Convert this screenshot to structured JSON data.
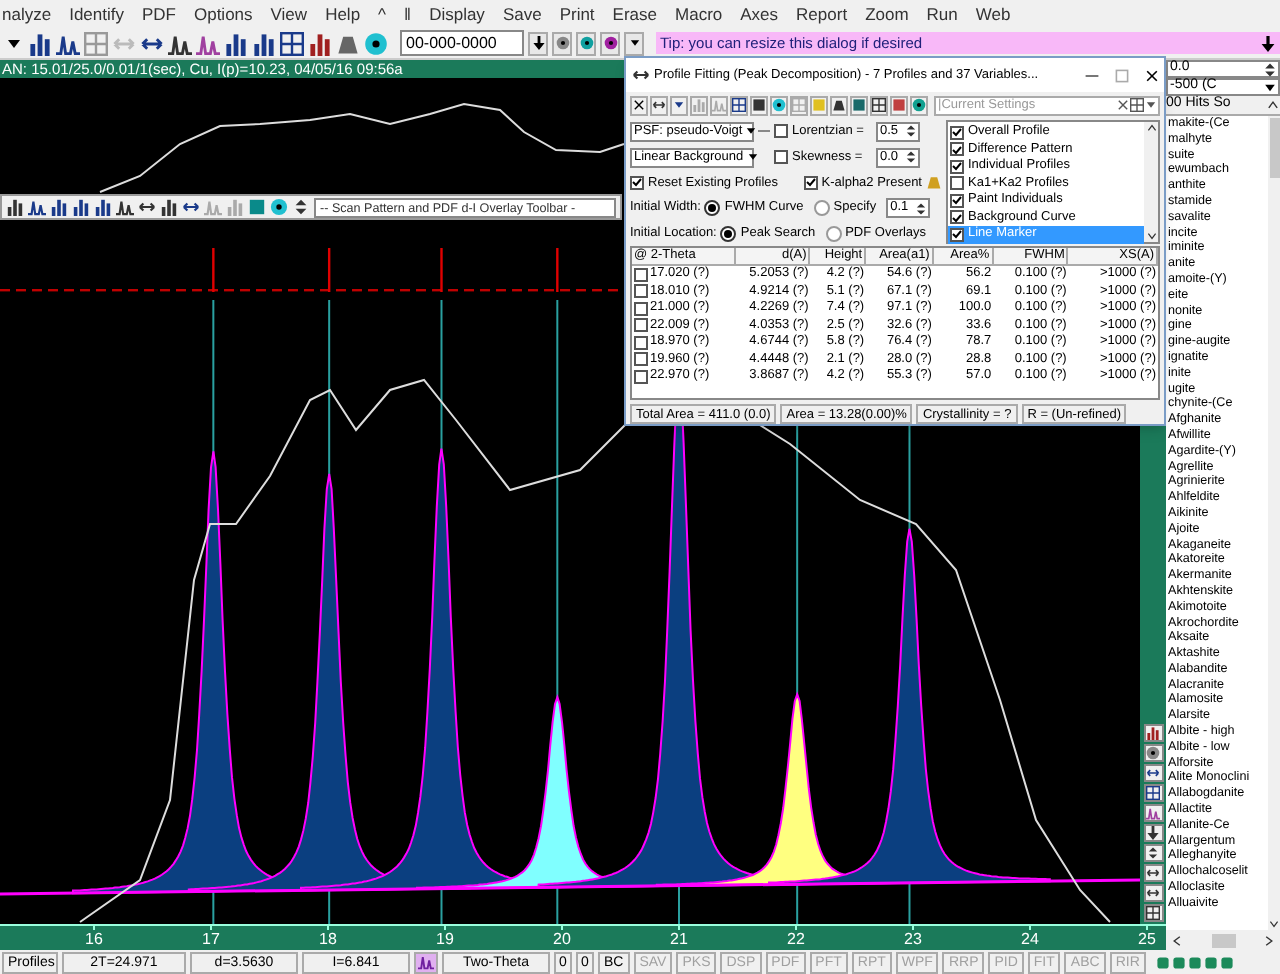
{
  "menu": [
    "nalyze",
    "Identify",
    "PDF",
    "Options",
    "View",
    "Help",
    "^",
    "‖",
    "Display",
    "Save",
    "Print",
    "Erase",
    "Macro",
    "Axes",
    "Report",
    "Zoom",
    "Run",
    "Web"
  ],
  "toolbar": {
    "pdf_field": "00-000-0000"
  },
  "tip": "Tip: you can resize this dialog if desired",
  "scan_title": "AN: 15.01/25.0/0.01/1(sec), Cu, I(p)=10.23, 04/05/16 09:56a",
  "overlay_toolbar": {
    "dropdown": "-- Scan Pattern and PDF d-I Overlay Toolbar -"
  },
  "x_axis": {
    "tick_labels": [
      "16",
      "17",
      "18",
      "19",
      "20",
      "21",
      "22",
      "23",
      "24",
      "25"
    ]
  },
  "dialog": {
    "title": "Profile Fitting (Peak Decomposition) - 7 Profiles and 37 Variables...",
    "settings_dropdown": "|Current Settings",
    "psf": "PSF: pseudo-Voigt",
    "background": "Linear Background",
    "lorentzian": {
      "label": "Lorentzian =",
      "checked": false,
      "value": "0.5"
    },
    "skewness": {
      "label": "Skewness =",
      "checked": false,
      "value": "0.0"
    },
    "reset_profiles": {
      "label": "Reset Existing Profiles",
      "checked": true
    },
    "kalpha2": {
      "label": "K-alpha2 Present",
      "checked": true
    },
    "initial_width": {
      "label": "Initial Width:",
      "options": [
        {
          "label": "FWHM Curve",
          "selected": true
        },
        {
          "label": "Specify",
          "selected": false
        }
      ],
      "value": "0.1"
    },
    "initial_location": {
      "label": "Initial Location:",
      "options": [
        {
          "label": "Peak Search",
          "selected": true
        },
        {
          "label": "PDF Overlays",
          "selected": false
        }
      ]
    },
    "display_options": [
      {
        "label": "Overall Profile",
        "checked": true,
        "selected": false
      },
      {
        "label": "Difference Pattern",
        "checked": true,
        "selected": false
      },
      {
        "label": "Individual Profiles",
        "checked": true,
        "selected": false
      },
      {
        "label": "Ka1+Ka2 Profiles",
        "checked": false,
        "selected": false
      },
      {
        "label": "Paint Individuals",
        "checked": true,
        "selected": false
      },
      {
        "label": "Background Curve",
        "checked": true,
        "selected": false
      },
      {
        "label": "Line Marker",
        "checked": true,
        "selected": true
      }
    ],
    "table": {
      "columns": [
        "@ 2-Theta",
        "d(A)",
        "Height",
        "Area(a1)",
        "Area%",
        "FWHM",
        "XS(A)"
      ],
      "rows": [
        {
          "checked": false,
          "cells": [
            "17.020 (?)",
            "5.2053 (?)",
            "4.2 (?)",
            "54.6 (?)",
            "56.2",
            "0.100 (?)",
            ">1000 (?)"
          ]
        },
        {
          "checked": false,
          "cells": [
            "18.010 (?)",
            "4.9214 (?)",
            "5.1 (?)",
            "67.1 (?)",
            "69.1",
            "0.100 (?)",
            ">1000 (?)"
          ]
        },
        {
          "checked": false,
          "cells": [
            "21.000 (?)",
            "4.2269 (?)",
            "7.4 (?)",
            "97.1 (?)",
            "100.0",
            "0.100 (?)",
            ">1000 (?)"
          ]
        },
        {
          "checked": false,
          "cells": [
            "22.009 (?)",
            "4.0353 (?)",
            "2.5 (?)",
            "32.6 (?)",
            "33.6",
            "0.100 (?)",
            ">1000 (?)"
          ]
        },
        {
          "checked": false,
          "cells": [
            "18.970 (?)",
            "4.6744 (?)",
            "5.8 (?)",
            "76.4 (?)",
            "78.7",
            "0.100 (?)",
            ">1000 (?)"
          ]
        },
        {
          "checked": false,
          "cells": [
            "19.960 (?)",
            "4.4448 (?)",
            "2.1 (?)",
            "28.0 (?)",
            "28.8",
            "0.100 (?)",
            ">1000 (?)"
          ]
        },
        {
          "checked": false,
          "cells": [
            "22.970 (?)",
            "3.8687 (?)",
            "4.2 (?)",
            "55.3 (?)",
            "57.0",
            "0.100 (?)",
            ">1000 (?)"
          ]
        }
      ]
    },
    "summary": [
      "Total Area = 411.0 (0.0)",
      "Area = 13.28(0.00)%",
      "Crystallinity = ?",
      "R = (Un-refined)"
    ]
  },
  "right_panel": {
    "offset_field": "0.0",
    "range_dropdown": "-500 (C",
    "list_header": "00 Hits So",
    "items": [
      "makite-(Ce",
      "malhyte",
      "suite",
      "ewumbach",
      "anthite",
      "stamide",
      "savalite",
      "incite",
      "iminite",
      "anite",
      "amoite-(Y)",
      "eite",
      "nonite",
      "gine",
      "gine-augite",
      "ignatite",
      "inite",
      "ugite",
      "chynite-(Ce",
      "Afghanite",
      "Afwillite",
      "Agardite-(Y)",
      "Agrellite",
      "Agrinierite",
      "Ahlfeldite",
      "Aikinite",
      "Ajoite",
      "Akaganeite",
      "Akatoreite",
      "Akermanite",
      "Akhtenskite",
      "Akimotoite",
      "Akrochordite",
      "Aksaite",
      "Aktashite",
      "Alabandite",
      "Alacranite",
      "Alamosite",
      "Alarsite",
      "Albite - high",
      "Albite - low",
      "Alforsite",
      "Alite Monoclini",
      "Allabogdanite",
      "Allactite",
      "Allanite-Ce",
      "Allargentum",
      "Alleghanyite",
      "Allochalcoselit",
      "Alloclasite",
      "Alluaivite"
    ]
  },
  "status_bar": {
    "fields": [
      "Profiles",
      "2T=24.971",
      "d=3.5630",
      "I=6.841"
    ],
    "axis_mode": "Two-Theta",
    "counters": [
      "0",
      "0"
    ],
    "tools": [
      {
        "label": "BC",
        "disabled": false
      },
      {
        "label": "SAV",
        "disabled": true
      },
      {
        "label": "PKS",
        "disabled": true
      },
      {
        "label": "DSP",
        "disabled": true
      },
      {
        "label": "PDF",
        "disabled": true
      },
      {
        "label": "PFT",
        "disabled": true
      },
      {
        "label": "RPT",
        "disabled": true
      },
      {
        "label": "WPF",
        "disabled": true
      },
      {
        "label": "RRP",
        "disabled": true
      },
      {
        "label": "PID",
        "disabled": true
      },
      {
        "label": "FIT",
        "disabled": true
      },
      {
        "label": "ABC",
        "disabled": true
      },
      {
        "label": "RIR",
        "disabled": true
      }
    ]
  }
}
